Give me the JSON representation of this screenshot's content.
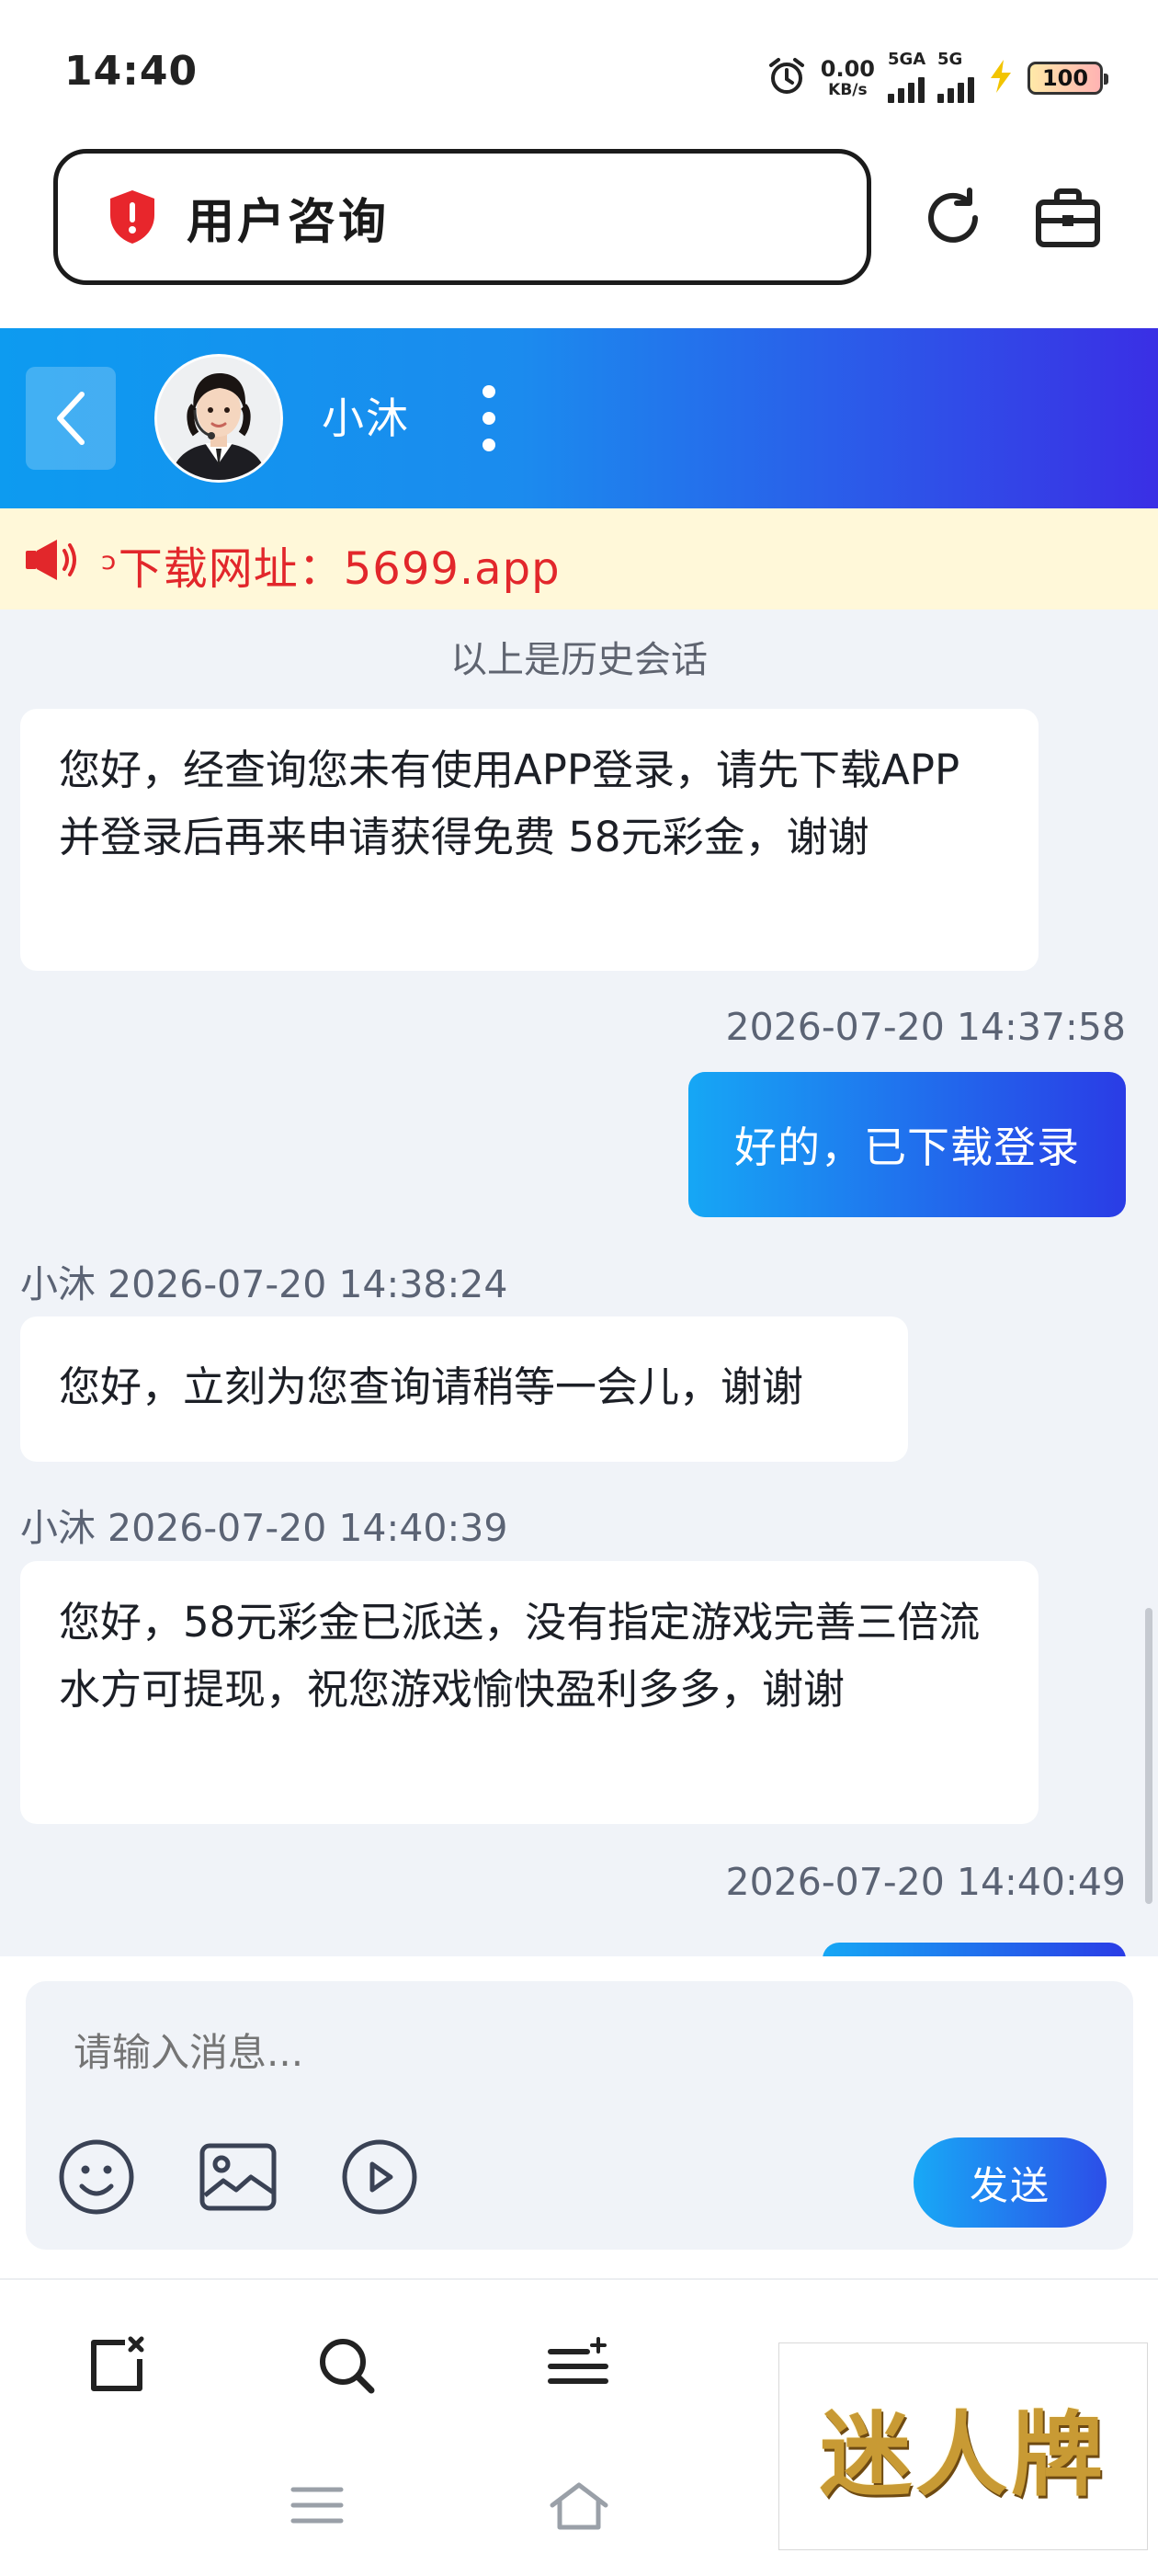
{
  "status_bar": {
    "time": "14:40",
    "net_speed_value": "0.00",
    "net_speed_unit": "KB/s",
    "signal1_label": "5GA",
    "signal2_label": "5G",
    "battery": "100"
  },
  "address_bar": {
    "title": "用户咨询"
  },
  "chat_header": {
    "agent_name": "小沐"
  },
  "notice": {
    "text": "ᵓ下载网址：5699.app"
  },
  "chat": {
    "history_label": "以上是历史会话",
    "messages": [
      {
        "from": "agent",
        "text": "您好，经查询您未有使用APP登录，请先下载APP并登录后再来申请获得免费 58元彩金，谢谢"
      },
      {
        "from": "user",
        "time": "2026-07-20 14:37:58",
        "text": "好的，已下载登录"
      },
      {
        "from": "agent",
        "meta": "小沐 2026-07-20 14:38:24",
        "text": "您好，立刻为您查询请稍等一会儿，谢谢"
      },
      {
        "from": "agent",
        "meta": "小沐 2026-07-20 14:40:39",
        "text": "您好，58元彩金已派送，没有指定游戏完善三倍流水方可提现，祝您游戏愉快盈利多多，谢谢"
      },
      {
        "from": "user",
        "time": "2026-07-20 14:40:49",
        "text": ""
      }
    ]
  },
  "composer": {
    "placeholder": "请输入消息...",
    "send_label": "发送"
  },
  "watermark": {
    "text": "迷人牌"
  },
  "colors": {
    "header_gradient_start": "#0d9bf0",
    "header_gradient_end": "#3a2fe5",
    "notice_text": "#e2272b",
    "chat_bg": "#f0f3f8"
  }
}
